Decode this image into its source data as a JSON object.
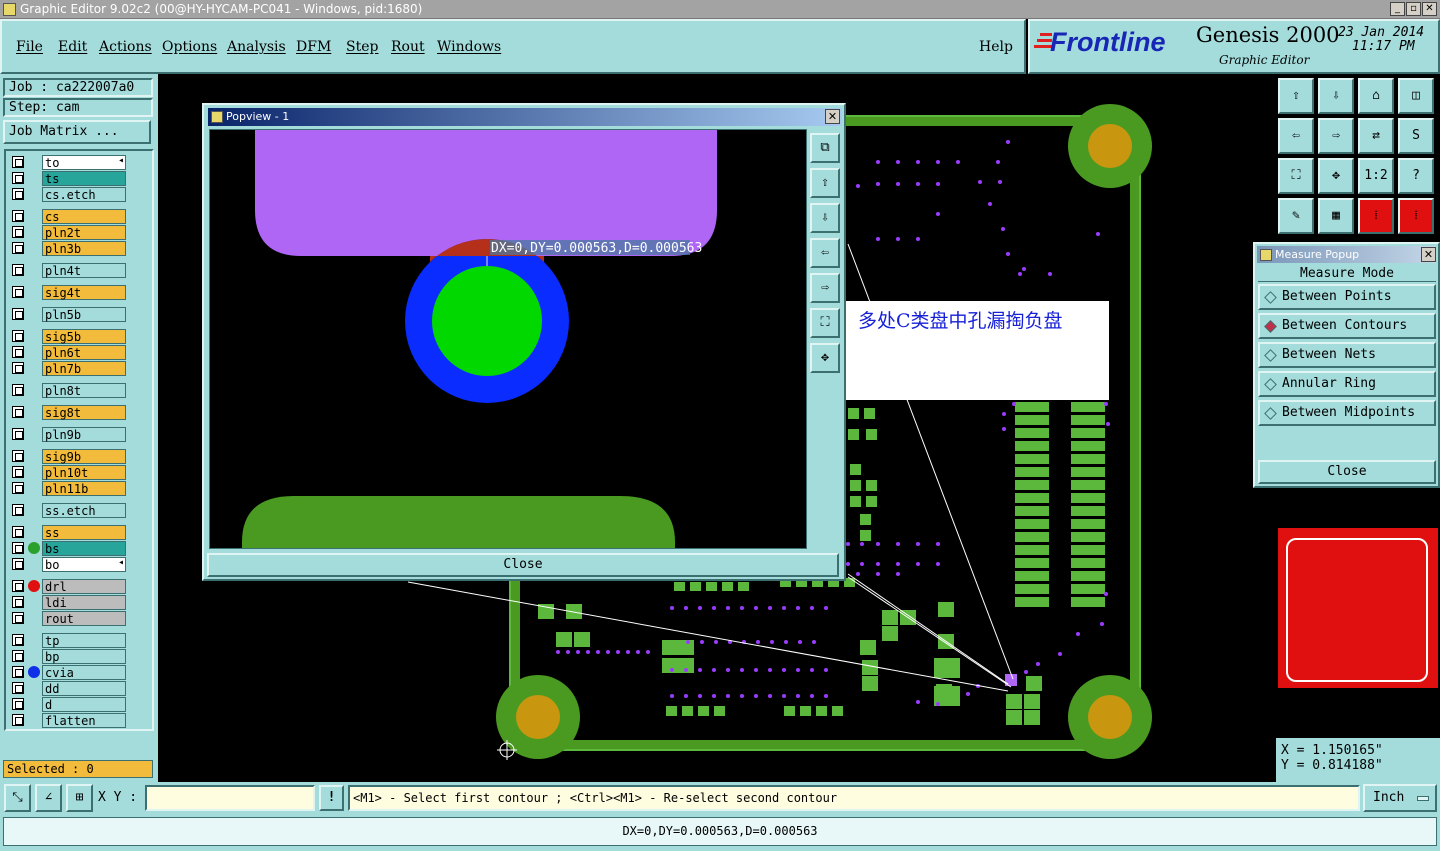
{
  "window": {
    "title": "Graphic Editor 9.02c2 (00@HY-HYCAM-PC041 - Windows, pid:1680)",
    "buttons": [
      "_",
      "▫",
      "✕"
    ]
  },
  "menu": {
    "items": [
      "File",
      "Edit",
      "Actions",
      "Options",
      "Analysis",
      "DFM",
      "Step",
      "Rout",
      "Windows"
    ],
    "help": "Help"
  },
  "brand": {
    "logo": "Frontline",
    "product": "Genesis 2000",
    "subtitle": "Graphic Editor",
    "date": "23 Jan 2014",
    "time": "11:17 PM"
  },
  "job": {
    "job_label": "Job : ca222007a0",
    "step_label": "Step: cam",
    "matrix_button": "Job Matrix ..."
  },
  "layers": [
    {
      "name": "to",
      "style": "w",
      "dot": "",
      "arrow": true
    },
    {
      "name": "ts",
      "style": "t",
      "dot": ""
    },
    {
      "name": "cs.etch",
      "style": "c",
      "dot": ""
    },
    {
      "name": "cs",
      "style": "y",
      "dot": ""
    },
    {
      "name": "pln2t",
      "style": "y",
      "dot": ""
    },
    {
      "name": "pln3b",
      "style": "y",
      "dot": ""
    },
    {
      "name": "pln4t",
      "style": "c",
      "dot": ""
    },
    {
      "name": "sig4t",
      "style": "y",
      "dot": ""
    },
    {
      "name": "pln5b",
      "style": "c",
      "dot": ""
    },
    {
      "name": "sig5b",
      "style": "y",
      "dot": ""
    },
    {
      "name": "pln6t",
      "style": "y",
      "dot": ""
    },
    {
      "name": "pln7b",
      "style": "y",
      "dot": ""
    },
    {
      "name": "pln8t",
      "style": "c",
      "dot": ""
    },
    {
      "name": "sig8t",
      "style": "y",
      "dot": ""
    },
    {
      "name": "pln9b",
      "style": "c",
      "dot": ""
    },
    {
      "name": "sig9b",
      "style": "y",
      "dot": ""
    },
    {
      "name": "pln10t",
      "style": "y",
      "dot": ""
    },
    {
      "name": "pln11b",
      "style": "y",
      "dot": ""
    },
    {
      "name": "ss.etch",
      "style": "c",
      "dot": ""
    },
    {
      "name": "ss",
      "style": "y",
      "dot": ""
    },
    {
      "name": "bs",
      "style": "t",
      "dot": "#2ca02c"
    },
    {
      "name": "bo",
      "style": "w",
      "dot": "",
      "arrow": true
    },
    {
      "name": "drl",
      "style": "g",
      "dot": "#e01010"
    },
    {
      "name": "ldi",
      "style": "g",
      "dot": ""
    },
    {
      "name": "rout",
      "style": "g",
      "dot": ""
    },
    {
      "name": "tp",
      "style": "c",
      "dot": ""
    },
    {
      "name": "bp",
      "style": "c",
      "dot": ""
    },
    {
      "name": "cvia",
      "style": "c",
      "dot": "#1030e8"
    },
    {
      "name": "dd",
      "style": "c",
      "dot": ""
    },
    {
      "name": "d",
      "style": "c",
      "dot": ""
    },
    {
      "name": "flatten",
      "style": "c",
      "dot": ""
    }
  ],
  "selected": "Selected : 0",
  "popview": {
    "title": "Popview - 1",
    "measure_label": "DX=0,DY=0.000563,D=0.000563",
    "close": "Close"
  },
  "annotation": "多处C类盘中孔漏掏负盘",
  "toolbar_icons": [
    "zoom-home",
    "zoom-back",
    "house",
    "split",
    "pan-left",
    "pan-right",
    "swap",
    "s-curve",
    "fit",
    "center",
    "ratio",
    "help",
    "ruler",
    "grid",
    "measure-a",
    "measure-b"
  ],
  "toolbar_text": {
    "ratio": "1:2",
    "help": "?"
  },
  "measure": {
    "title": "Measure Popup",
    "mode_label": "Measure Mode",
    "options": [
      "Between Points",
      "Between Contours",
      "Between Nets",
      "Annular Ring",
      "Between Midpoints"
    ],
    "selected": "Between Contours",
    "close": "Close"
  },
  "coords": {
    "x": "X = 1.150165\"",
    "y": "Y = 0.814188\""
  },
  "status": {
    "xy_label": "X Y :",
    "xy_value": "",
    "hint": "<M1> - Select first contour ; <Ctrl><M1> - Re-select second contour",
    "units": "Inch",
    "result": "DX=0,DY=0.000563,D=0.000563"
  },
  "colors": {
    "panel": "#a4dcdc",
    "board": "#4a9a22",
    "pad": "#5cb83c",
    "via": "#9a3cff",
    "mounting": "#c8960f",
    "pop_purple": "#b066f5",
    "pop_ring": "#0a2cff",
    "pop_pad": "#00d800"
  }
}
